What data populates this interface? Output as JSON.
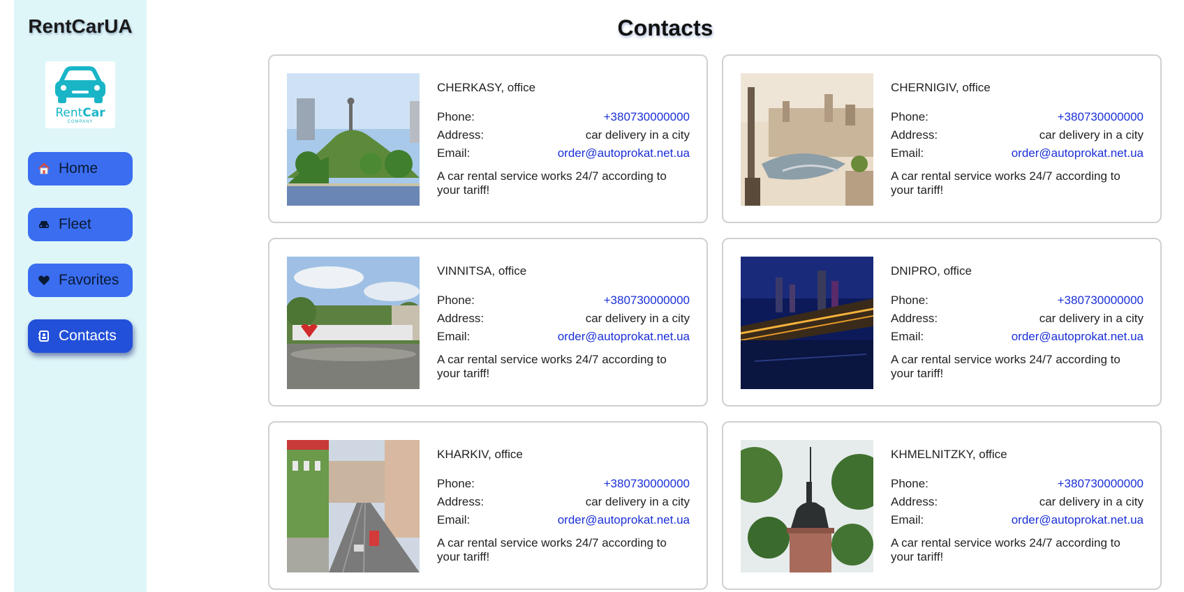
{
  "sidebar": {
    "brand": "RentCarUA",
    "logo": {
      "word_light": "Rent",
      "word_bold": "Car",
      "sub": "COMPANY"
    },
    "nav": [
      {
        "label": "Home",
        "icon": "home-icon"
      },
      {
        "label": "Fleet",
        "icon": "car-icon"
      },
      {
        "label": "Favorites",
        "icon": "heart-icon"
      },
      {
        "label": "Contacts",
        "icon": "address-book-icon",
        "active": true
      }
    ]
  },
  "main": {
    "title": "Contacts",
    "labels": {
      "phone": "Phone:",
      "address": "Address:",
      "email": "Email:"
    },
    "offices": [
      {
        "city": "CHERKASY",
        "suffix": ", office",
        "phone": "+380730000000",
        "address": "car delivery in a city",
        "email": "order@autoprokat.net.ua",
        "desc": "A car rental service works 24/7 according to your tariff!"
      },
      {
        "city": "CHERNIGIV",
        "suffix": ", office",
        "phone": "+380730000000",
        "address": "car delivery in a city",
        "email": "order@autoprokat.net.ua",
        "desc": "A car rental service works 24/7 according to your tariff!"
      },
      {
        "city": "VINNITSA",
        "suffix": ", office",
        "phone": "+380730000000",
        "address": "car delivery in a city",
        "email": "order@autoprokat.net.ua",
        "desc": "A car rental service works 24/7 according to your tariff!"
      },
      {
        "city": "DNIPRO",
        "suffix": ", office",
        "phone": "+380730000000",
        "address": "car delivery in a city",
        "email": "order@autoprokat.net.ua",
        "desc": "A car rental service works 24/7 according to your tariff!"
      },
      {
        "city": "KHARKIV",
        "suffix": ", office",
        "phone": "+380730000000",
        "address": "car delivery in a city",
        "email": "order@autoprokat.net.ua",
        "desc": "A car rental service works 24/7 according to your tariff!"
      },
      {
        "city": "KHMELNITZKY",
        "suffix": ", office",
        "phone": "+380730000000",
        "address": "car delivery in a city",
        "email": "order@autoprokat.net.ua",
        "desc": "A car rental service works 24/7 according to your tariff!"
      }
    ]
  },
  "colors": {
    "accent": "#3a6df0",
    "active": "#2350d8",
    "link": "#1a2fd6",
    "sidebar_bg": "#dff6f8",
    "logo": "#19b5c7"
  }
}
